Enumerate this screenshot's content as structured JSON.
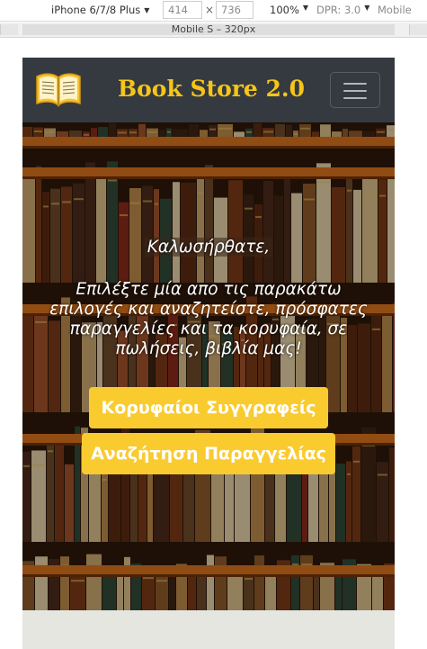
{
  "devtools": {
    "device": "iPhone 6/7/8 Plus",
    "width": "414",
    "times": "×",
    "height": "736",
    "zoom": "100%",
    "dpr": "DPR: 3.0",
    "throttle": "Mobile"
  },
  "media_query": {
    "label": "Mobile S – 320px"
  },
  "page": {
    "brand": "Book Store 2.0",
    "logo_icon": "open-book-icon",
    "menu_icon": "hamburger-menu-icon",
    "hero": {
      "welcome": "Καλωσήρθατε,",
      "message": "Επιλέξτε μία απο τις παρακάτω επιλογές και αναζητείστε, πρόσφατες παραγγελίες και τα κορυφαία, σε πωλήσεις, βιβλία μας!",
      "button_authors": "Κορυφαίοι Συγγραφείς",
      "button_orders": "Αναζήτηση Παραγγελίας"
    }
  },
  "colors": {
    "navbar": "#343a40",
    "brand": "#f5c518",
    "button": "#f9cb2f",
    "footer": "#e6e6e1"
  }
}
